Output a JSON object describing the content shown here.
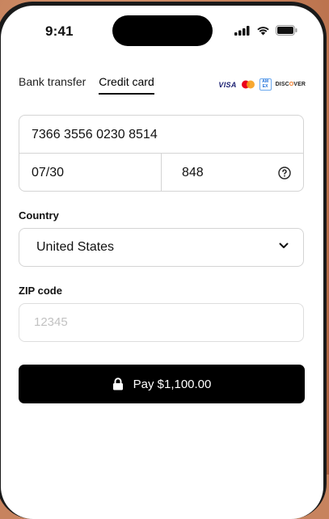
{
  "status_bar": {
    "time": "9:41"
  },
  "payment_tabs": [
    {
      "label": "Bank transfer",
      "active": false
    },
    {
      "label": "Credit card",
      "active": true
    }
  ],
  "card_brands": {
    "visa": "VISA",
    "amex_line1": "AM",
    "amex_line2": "EX",
    "discover_pre": "DISC",
    "discover_o": "O",
    "discover_post": "VER",
    "mastercard_icon": "mastercard-icon"
  },
  "card": {
    "number": "7366 3556 0230 8514",
    "expiry": "07/30",
    "cvc": "848",
    "cvc_help_icon": "question-circle-icon"
  },
  "country": {
    "label": "Country",
    "selected": "United States",
    "icon": "chevron-down-icon"
  },
  "zip": {
    "label": "ZIP code",
    "placeholder": "12345",
    "value": ""
  },
  "pay_button": {
    "label": "Pay $1,100.00",
    "icon": "lock-icon"
  },
  "colors": {
    "background": "#c7835e",
    "button": "#000000",
    "border": "#d4d4d4"
  }
}
